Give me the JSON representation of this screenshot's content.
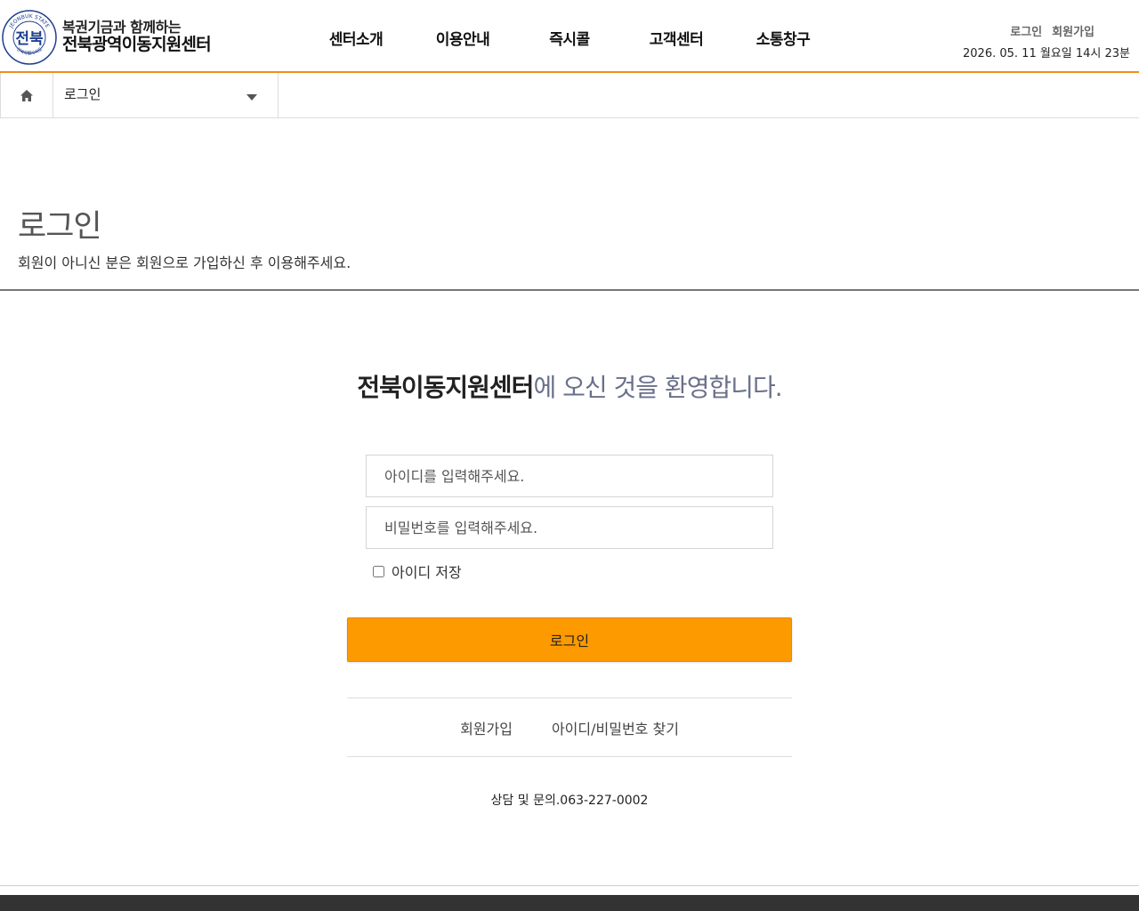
{
  "header": {
    "seal_text": "전북",
    "seal_ring_top": "JEONBUK STATE",
    "seal_ring_bottom": "전북특별자치도",
    "logo_line1": "복권기금과 함께하는",
    "logo_line2": "전북광역이동지원센터",
    "nav": [
      "센터소개",
      "이용안내",
      "즉시콜",
      "고객센터",
      "소통창구"
    ],
    "login_link": "로그인",
    "join_link": "회원가입",
    "datetime": "2026. 05. 11 월요일 14시 23분",
    "accent_color": "#f08c1e"
  },
  "breadcrumb": {
    "home_icon": "home-icon",
    "current": "로그인"
  },
  "page": {
    "title": "로그인",
    "description": "회원이 아니신 분은 회원으로 가입하신 후 이용해주세요."
  },
  "login": {
    "welcome_strong": "전북이동지원센터",
    "welcome_rest": "에 오신 것을 환영합니다.",
    "id_placeholder": "아이디를 입력해주세요.",
    "pw_placeholder": "비밀번호를 입력해주세요.",
    "save_id_label": "아이디 저장",
    "save_id_checked": false,
    "submit_label": "로그인",
    "submit_color": "#fd9a00",
    "join_label": "회원가입",
    "find_label": "아이디/비밀번호 찾기",
    "contact": "상담 및 문의.063-227-0002"
  }
}
